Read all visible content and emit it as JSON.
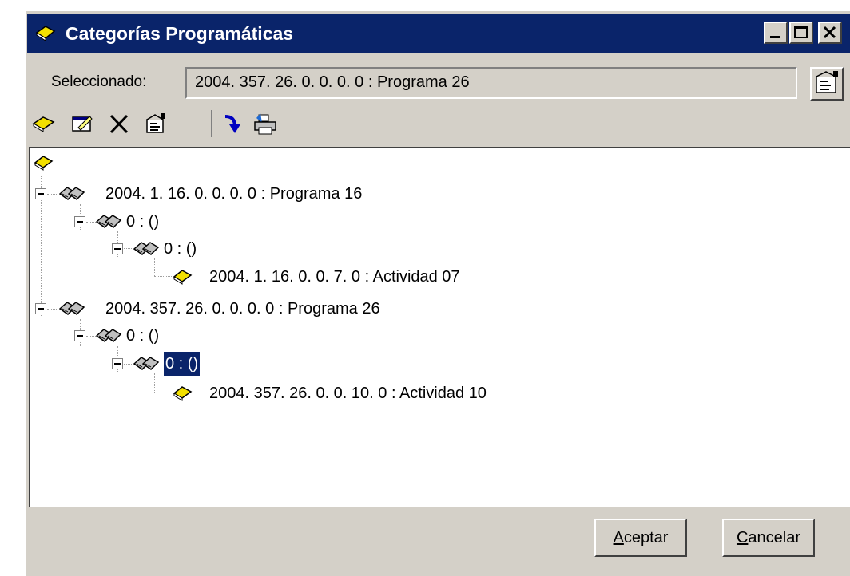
{
  "window": {
    "title": "Categorías Programáticas",
    "controls": [
      "minimize-icon",
      "maximize-icon",
      "close-icon"
    ]
  },
  "selected": {
    "label": "Seleccionado:",
    "value": "2004. 357. 26. 0. 0. 0. 0 : Programa 26"
  },
  "toolbar": {
    "icons": [
      "new-book-icon",
      "edit-icon",
      "delete-icon",
      "properties-icon",
      "move-down-icon",
      "print-icon"
    ]
  },
  "tree": {
    "root_icon": "book-icon",
    "nodes": [
      {
        "label": "2004. 1. 16. 0. 0. 0. 0 : Programa 16",
        "level": 1,
        "icon": "books-icon"
      },
      {
        "label": "0 : ()",
        "level": 2,
        "icon": "books-icon"
      },
      {
        "label": "0 : ()",
        "level": 3,
        "icon": "books-icon"
      },
      {
        "label": "2004. 1. 16. 0. 0. 7. 0 : Actividad 07",
        "level": 4,
        "icon": "book-icon"
      },
      {
        "label": "2004. 357. 26. 0. 0. 0. 0 : Programa 26",
        "level": 1,
        "icon": "books-icon"
      },
      {
        "label": "0 : ()",
        "level": 2,
        "icon": "books-icon"
      },
      {
        "label": "0 : ()",
        "level": 3,
        "icon": "books-icon",
        "selected": true
      },
      {
        "label": "2004. 357. 26. 0. 0. 10. 0 : Actividad 10",
        "level": 4,
        "icon": "book-icon"
      }
    ]
  },
  "buttons": {
    "accept": {
      "accel": "A",
      "rest": "ceptar"
    },
    "cancel": {
      "accel": "C",
      "rest": "ancelar"
    }
  },
  "colors": {
    "titlebar": "#0a246a",
    "face": "#d4d0c8",
    "book": "#f2e000"
  }
}
